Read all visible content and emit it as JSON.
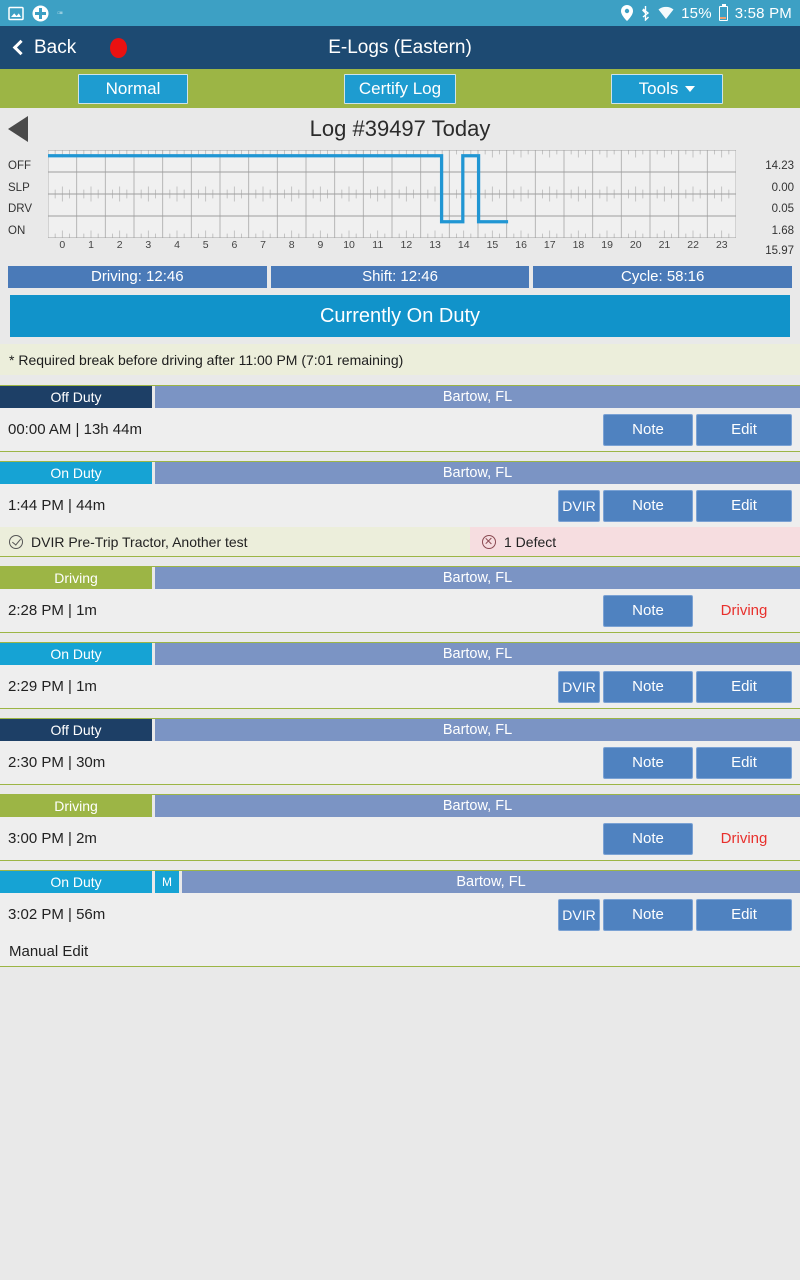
{
  "status_bar": {
    "left_icons": [
      "image-icon",
      "medical-cross-icon",
      "misc-icon"
    ],
    "right_icons": [
      "location-icon",
      "bluetooth-icon",
      "wifi-icon"
    ],
    "battery_percent": "15%",
    "clock": "3:58 PM"
  },
  "title_bar": {
    "back_label": "Back",
    "record_indicator": "recording-dot",
    "title": "E-Logs (Eastern)"
  },
  "toolbar": {
    "normal_label": "Normal",
    "certify_label": "Certify Log",
    "tools_label": "Tools"
  },
  "log_header": {
    "prev_arrow": "previous-day-arrow",
    "title": "Log #39497 Today"
  },
  "chart_data": {
    "type": "line",
    "title": "Log #39497 Today",
    "xlabel": "",
    "ylabel": "",
    "row_labels": [
      "OFF",
      "SLP",
      "DRV",
      "ON"
    ],
    "hour_ticks": [
      "0",
      "1",
      "2",
      "3",
      "4",
      "5",
      "6",
      "7",
      "8",
      "9",
      "10",
      "11",
      "12",
      "13",
      "14",
      "15",
      "16",
      "17",
      "18",
      "19",
      "20",
      "21",
      "22",
      "23"
    ],
    "xlim": [
      0,
      24
    ],
    "grid": true,
    "line_color": "#2196d3",
    "totals": [
      "14.23",
      "0.00",
      "0.05",
      "1.68"
    ],
    "grand_total": "15.97",
    "segments": [
      {
        "status": "OFF",
        "start": 0.0,
        "end": 13.73
      },
      {
        "status": "ON",
        "start": 13.73,
        "end": 14.47
      },
      {
        "status": "OFF",
        "start": 14.47,
        "end": 15.02
      },
      {
        "status": "ON",
        "start": 15.02,
        "end": 16.05
      }
    ]
  },
  "summary": {
    "driving": "Driving: 12:46",
    "shift": "Shift: 12:46",
    "cycle": "Cycle: 58:16"
  },
  "banner": {
    "text": "Currently On Duty"
  },
  "warning": {
    "text": "* Required break before driving after 11:00 PM (7:01 remaining)"
  },
  "entries": [
    {
      "status": "Off Duty",
      "status_kind": "off",
      "manual": false,
      "location": "Bartow,  FL",
      "time": "00:00 AM | 13h 44m",
      "buttons": [
        "Note",
        "Edit"
      ],
      "driving_flag": null,
      "note": null,
      "defect": null,
      "sub": null
    },
    {
      "status": "On Duty",
      "status_kind": "on",
      "manual": false,
      "location": "Bartow,  FL",
      "time": "1:44 PM | 44m",
      "buttons": [
        "DVIR",
        "Note",
        "Edit"
      ],
      "driving_flag": null,
      "note": "DVIR Pre-Trip Tractor, Another test",
      "defect": "1 Defect",
      "sub": null
    },
    {
      "status": "Driving",
      "status_kind": "driving",
      "manual": false,
      "location": "Bartow,  FL",
      "time": "2:28 PM | 1m",
      "buttons": [
        "Note"
      ],
      "driving_flag": "Driving",
      "note": null,
      "defect": null,
      "sub": null
    },
    {
      "status": "On Duty",
      "status_kind": "on",
      "manual": false,
      "location": "Bartow,  FL",
      "time": "2:29 PM | 1m",
      "buttons": [
        "DVIR",
        "Note",
        "Edit"
      ],
      "driving_flag": null,
      "note": null,
      "defect": null,
      "sub": null
    },
    {
      "status": "Off Duty",
      "status_kind": "off",
      "manual": false,
      "location": "Bartow,  FL",
      "time": "2:30 PM | 30m",
      "buttons": [
        "Note",
        "Edit"
      ],
      "driving_flag": null,
      "note": null,
      "defect": null,
      "sub": null
    },
    {
      "status": "Driving",
      "status_kind": "driving",
      "manual": false,
      "location": "Bartow,  FL",
      "time": "3:00 PM | 2m",
      "buttons": [
        "Note"
      ],
      "driving_flag": "Driving",
      "note": null,
      "defect": null,
      "sub": null
    },
    {
      "status": "On Duty",
      "status_kind": "on",
      "manual": true,
      "manual_badge": "M",
      "location": "Bartow,  FL",
      "time": "3:02 PM | 56m",
      "buttons": [
        "DVIR",
        "Note",
        "Edit"
      ],
      "driving_flag": null,
      "note": null,
      "defect": null,
      "sub": "Manual Edit"
    }
  ],
  "colors": {
    "status_bar": "#3da0c4",
    "title_bar": "#1d4a72",
    "toolbar": "#9cb545",
    "accent_blue": "#1e9cd0",
    "banner": "#1193ca",
    "off_duty": "#1d3f66",
    "on_duty": "#16a3d4",
    "driving": "#9cb545",
    "location_bar": "#7b94c4",
    "row_button": "#4f82c0",
    "driving_text": "#e8302c"
  }
}
